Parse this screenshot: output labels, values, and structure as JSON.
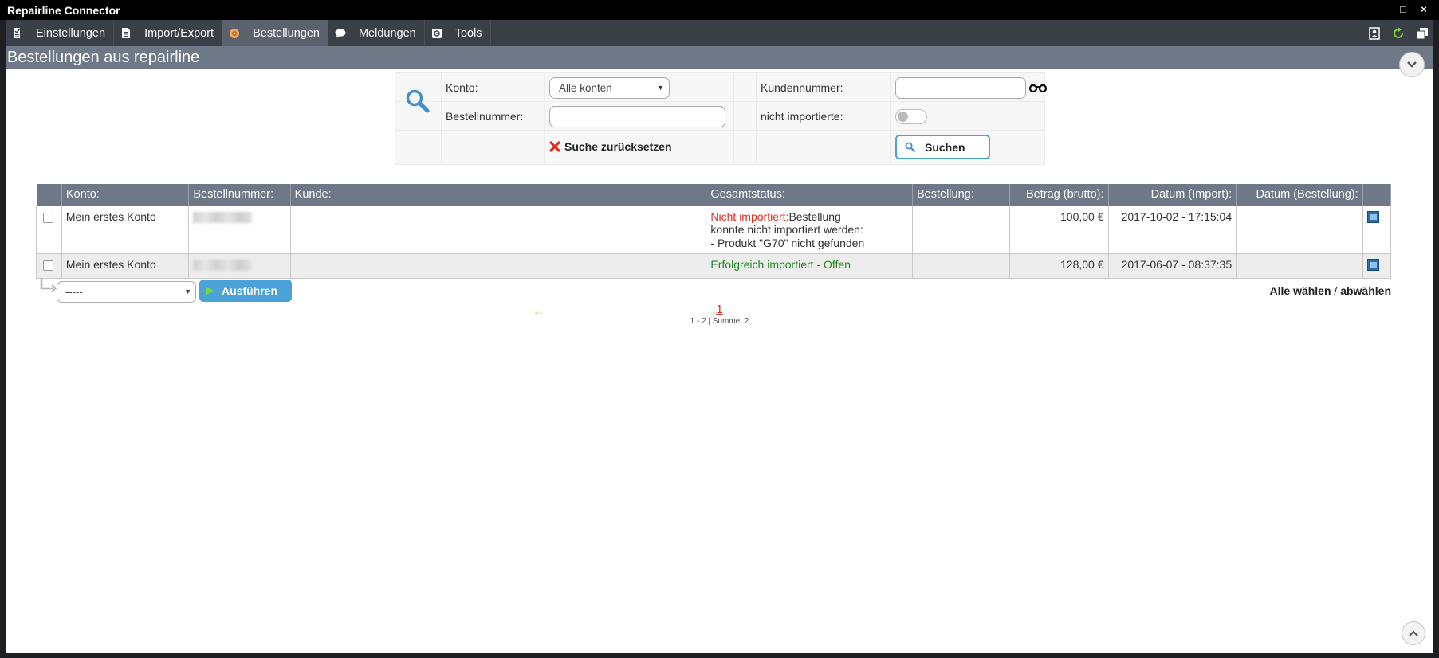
{
  "window": {
    "title": "Repairline Connector",
    "controls": [
      "_",
      "□",
      "×"
    ]
  },
  "menu": {
    "items": [
      {
        "label": "Einstellungen",
        "icon": "checklist-icon",
        "active": false
      },
      {
        "label": "Import/Export",
        "icon": "document-icon",
        "active": false
      },
      {
        "label": "Bestellungen",
        "icon": "orders-icon",
        "active": true
      },
      {
        "label": "Meldungen",
        "icon": "chat-bubble-icon",
        "active": false
      },
      {
        "label": "Tools",
        "icon": "tools-icon",
        "active": false
      }
    ]
  },
  "page": {
    "title": "Bestellungen aus repairline"
  },
  "search": {
    "konto_label": "Konto:",
    "konto_value": "Alle konten",
    "kundennummer_label": "Kundennummer:",
    "kundennummer_value": "",
    "bestellnummer_label": "Bestellnummer:",
    "bestellnummer_value": "",
    "nicht_importierte_label": "nicht importierte:",
    "reset_label": "Suche zurücksetzen",
    "search_label": "Suchen"
  },
  "table": {
    "headers": {
      "konto": "Konto:",
      "bestellnummer": "Bestellnummer:",
      "kunde": "Kunde:",
      "gesamtstatus": "Gesamtstatus:",
      "bestellung": "Bestellung:",
      "betrag": "Betrag (brutto):",
      "datum_import": "Datum (Import):",
      "datum_bestellung": "Datum (Bestellung):"
    },
    "rows": [
      {
        "konto": "Mein erstes Konto",
        "kunde": "",
        "status_prefix": "Nicht importiert:",
        "status_line1": "Bestellung",
        "status_line2": "konnte nicht importiert werden:",
        "status_line3": "- Produkt \"G70\" nicht gefunden",
        "bestellung": "",
        "betrag": "100,00 €",
        "datum_import": "2017-10-02 - 17:15:04",
        "datum_bestellung": ""
      },
      {
        "konto": "Mein erstes Konto",
        "kunde": "",
        "status_prefix": "Erfolgreich importiert - Offen",
        "bestellung": "",
        "betrag": "128,00 €",
        "datum_import": "2017-06-07 - 08:37:35",
        "datum_bestellung": ""
      }
    ]
  },
  "bulk": {
    "action_value": "-----",
    "run_label": "Ausführen",
    "select_all": "Alle wählen",
    "separator": "/",
    "deselect_all": "abwählen"
  },
  "pager": {
    "current": "1",
    "summary": "1 - 2 | Summe: 2",
    "prev": "←",
    "next": "→"
  },
  "colors": {
    "accent": "#4aa2d8",
    "header_bg": "#6f7886",
    "error": "#e02b20",
    "success": "#1d8a1d"
  }
}
